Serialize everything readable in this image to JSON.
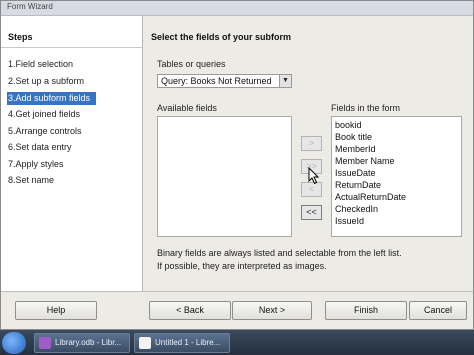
{
  "window": {
    "title": "Form Wizard"
  },
  "steps": {
    "title": "Steps",
    "items": [
      {
        "label": "1.Field selection",
        "active": false
      },
      {
        "label": "2.Set up a subform",
        "active": false
      },
      {
        "label": "3.Add subform fields",
        "active": true
      },
      {
        "label": "4.Get joined fields",
        "active": false
      },
      {
        "label": "5.Arrange controls",
        "active": false
      },
      {
        "label": "6.Set data entry",
        "active": false
      },
      {
        "label": "7.Apply styles",
        "active": false
      },
      {
        "label": "8.Set name",
        "active": false
      }
    ]
  },
  "main": {
    "heading": "Select the fields of your subform",
    "tables_label": "Tables or queries",
    "tables_value": "Query: Books Not Returned",
    "available_label": "Available fields",
    "available_items": [],
    "form_label": "Fields in the form",
    "form_items": [
      "bookid",
      "Book title",
      "MemberId",
      "Member Name",
      "IssueDate",
      "ReturnDate",
      "ActualReturnDate",
      "CheckedIn",
      "IssueId"
    ],
    "move_buttons": {
      "add": ">",
      "add_all": ">>",
      "remove": "<",
      "remove_all": "<<"
    },
    "note_line1": "Binary fields are always listed and selectable from the left list.",
    "note_line2": "If possible, they are interpreted as images."
  },
  "buttons": {
    "help": "Help",
    "back": "< Back",
    "next": "Next >",
    "finish": "Finish",
    "cancel": "Cancel"
  },
  "taskbar": {
    "items": [
      {
        "label": "Library.odb - Libr..."
      },
      {
        "label": "Untitled 1 - Libre..."
      }
    ]
  }
}
